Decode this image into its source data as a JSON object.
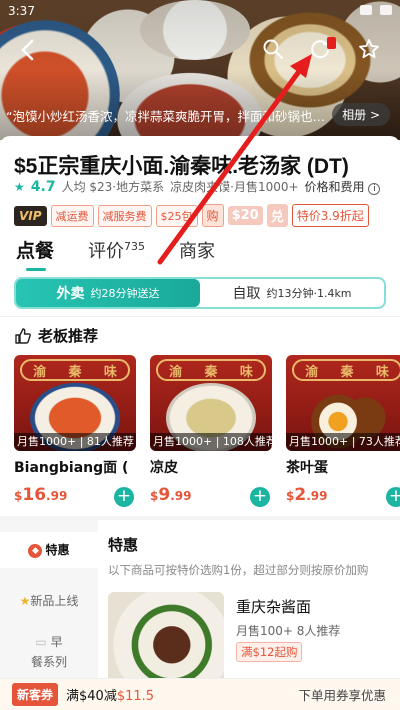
{
  "status_bar": {
    "time": "3:37"
  },
  "header": {
    "caption": "“泡馍小炒红汤香浓，凉拌蒜菜爽脆开胃，拌面和砂锅也…",
    "album_label": "相册 >"
  },
  "store": {
    "name": "$5正宗重庆小面.渝秦味.老汤家 (DT)",
    "rating": "4.7",
    "per_person": "人均 $23·地方菜系",
    "category_sales": "凉皮肉夹馍·月售1000+",
    "fee_label": "价格和费用",
    "promos": {
      "vip": "VIP",
      "tag1": "减运费",
      "tag2": "减服务费",
      "tag3": "$25包",
      "buy": "购",
      "redeem_amount": "$20",
      "redeem_label": "兑",
      "special": "特价3.9折起"
    }
  },
  "tabs": [
    {
      "label": "点餐",
      "count": ""
    },
    {
      "label": "评价",
      "count": "735"
    },
    {
      "label": "商家",
      "count": ""
    }
  ],
  "modes": {
    "delivery": {
      "label": "外卖",
      "sub": "约28分钟送达"
    },
    "pickup": {
      "label": "自取",
      "sub": "约13分钟·1.4km"
    }
  },
  "recommend": {
    "title": "老板推荐",
    "banner_chars": [
      "渝",
      "秦",
      "味"
    ],
    "items": [
      {
        "name": "Biangbiang面 (",
        "stat": "月售1000+ | 81人推荐",
        "currency": "$",
        "price": "16.99",
        "price_whole": "16",
        "price_dec": ".99"
      },
      {
        "name": "凉皮",
        "stat": "月售1000+ | 108人推荐",
        "currency": "$",
        "price": "9.99",
        "price_whole": "9",
        "price_dec": ".99"
      },
      {
        "name": "茶叶蛋",
        "stat": "月售1000+ | 73人推荐",
        "currency": "$",
        "price": "2.99",
        "price_whole": "2",
        "price_dec": ".99"
      }
    ]
  },
  "menu": {
    "categories": [
      {
        "label": "特惠",
        "active": true
      },
      {
        "label": "新品上线",
        "active": false
      },
      {
        "label": "早",
        "active": false
      },
      {
        "label": "餐系列",
        "active": false
      }
    ],
    "section_title": "特惠",
    "section_desc": "以下商品可按特价选购1份，超过部分则按原价加购",
    "dish": {
      "name": "重庆杂酱面",
      "sales": "月售100+ 8人推荐",
      "tag": "满$12起购"
    }
  },
  "bottom_bar": {
    "newbie_label": "新客券",
    "offer_prefix": "满$40减",
    "offer_amount": "$11.5",
    "hint": "下单用券享优惠"
  },
  "colors": {
    "accent": "#1bb5a2",
    "price_red": "#e4553a",
    "annotation_red": "#e51d1d"
  }
}
